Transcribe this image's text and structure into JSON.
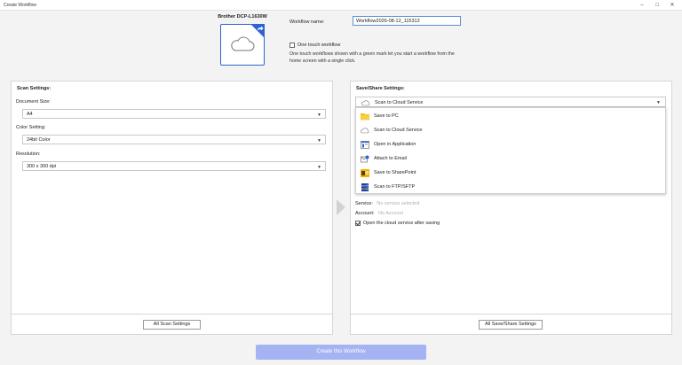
{
  "window": {
    "title": "Create Workflow"
  },
  "device": {
    "name": "Brother DCP-L1630W"
  },
  "workflow": {
    "name_label": "Workflow name:",
    "name_value": "Workflow2026-08-12_115312",
    "one_touch_label": "One touch workflow",
    "one_touch_checked": false,
    "one_touch_description": "One touch workflows shown with a green mark let you start a workflow from the home screen with a single click."
  },
  "scan_settings": {
    "title": "Scan Settings:",
    "document_size_label": "Document Size:",
    "document_size_value": "A4",
    "color_setting_label": "Color Setting:",
    "color_setting_value": "24bit Color",
    "resolution_label": "Resolution:",
    "resolution_value": "300 x 300 dpi",
    "all_button": "All Scan Settings"
  },
  "save_share": {
    "title": "Save/Share Settings:",
    "selected": "Scan to Cloud Service",
    "options": [
      {
        "label": "Save to PC",
        "icon": "folder-icon"
      },
      {
        "label": "Scan to Cloud Service",
        "icon": "cloud-icon"
      },
      {
        "label": "Open in Application",
        "icon": "application-icon"
      },
      {
        "label": "Attach to Email",
        "icon": "email-icon"
      },
      {
        "label": "Save to SharePoint",
        "icon": "sharepoint-icon"
      },
      {
        "label": "Scan to FTP/SFTP",
        "icon": "server-icon"
      }
    ],
    "service_label": "Service:",
    "service_value": "No service selected",
    "account_label": "Account:",
    "account_value": "No Account",
    "open_after_label": "Open the cloud service after saving",
    "open_after_checked": true,
    "all_button": "All Save/Share Settings"
  },
  "footer": {
    "create_button": "Create this Workflow"
  },
  "colors": {
    "accent": "#2f62d6",
    "create_button_bg": "#a5b3f2"
  }
}
